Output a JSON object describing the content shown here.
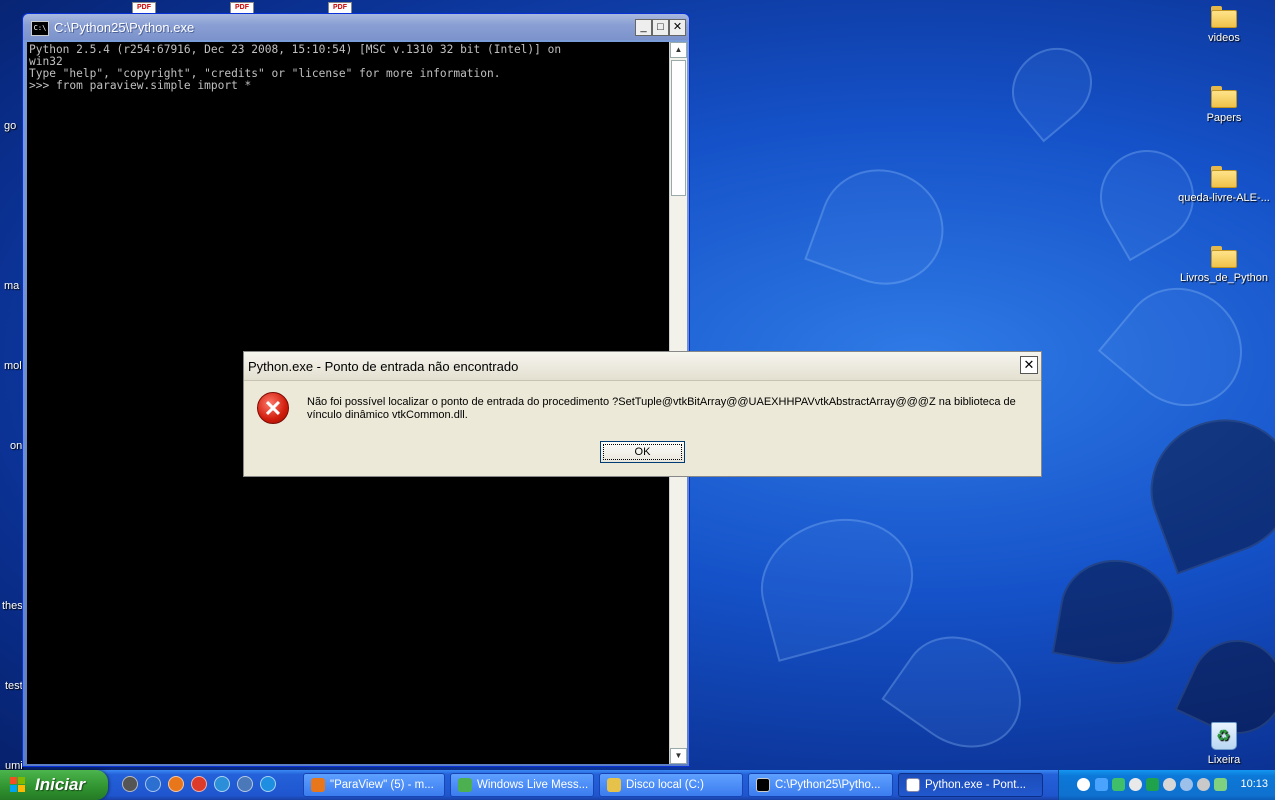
{
  "desktop": {
    "left_partial_labels": [
      "go",
      "ma",
      "moll",
      "on",
      "thes",
      "test",
      "umi"
    ],
    "top_pdf_badge": "PDF",
    "icons": [
      {
        "label": "videos"
      },
      {
        "label": "Papers"
      },
      {
        "label": "queda-livre-ALE-..."
      },
      {
        "label": "Livros_de_Python"
      },
      {
        "label": "Lixeira"
      }
    ]
  },
  "console": {
    "title": "C:\\Python25\\Python.exe",
    "icon_text": "C:\\",
    "minimize": "_",
    "maximize": "□",
    "close": "✕",
    "output": "Python 2.5.4 (r254:67916, Dec 23 2008, 15:10:54) [MSC v.1310 32 bit (Intel)] on\nwin32\nType \"help\", \"copyright\", \"credits\" or \"license\" for more information.\n>>> from paraview.simple import *"
  },
  "dialog": {
    "title": "Python.exe - Ponto de entrada não encontrado",
    "close": "✕",
    "icon": "error-icon",
    "message": "Não foi possível localizar o ponto de entrada do procedimento ?SetTuple@vtkBitArray@@UAEXHHPAVvtkAbstractArray@@@Z na biblioteca de vínculo dinâmico vtkCommon.dll.",
    "ok_label": "OK"
  },
  "taskbar": {
    "start_label": "Iniciar",
    "tasks": [
      {
        "label": "\"ParaView\" (5) - m..."
      },
      {
        "label": "Windows Live Mess..."
      },
      {
        "label": "Disco local (C:)"
      },
      {
        "label": "C:\\Python25\\Pytho..."
      },
      {
        "label": "Python.exe - Pont..."
      }
    ],
    "clock": "10:13"
  },
  "colors": {
    "xp_blue": "#2461d9",
    "start_green": "#2f922f",
    "dialog_bg": "#ece9d8",
    "error_red": "#d01c0c"
  }
}
